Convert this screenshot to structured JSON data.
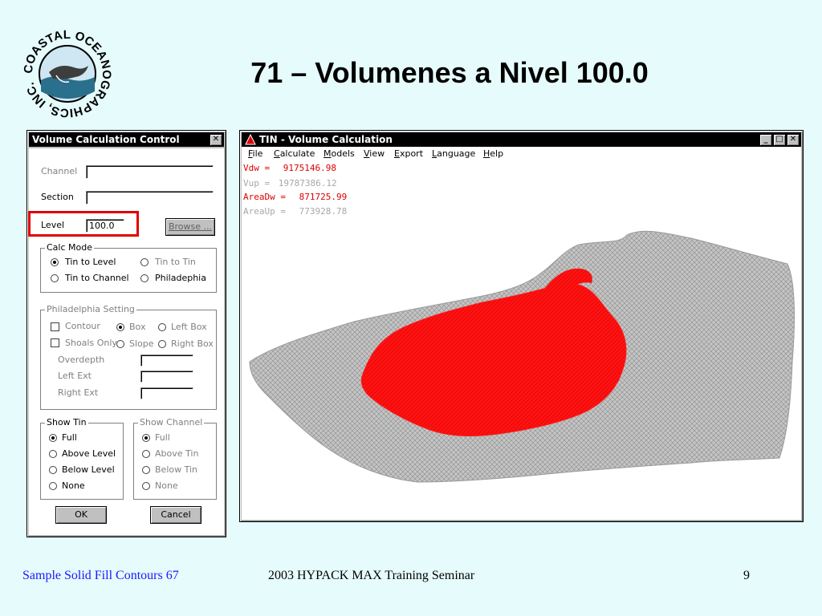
{
  "slide": {
    "title": "71 – Volumenes a Nivel 100.0",
    "logo_text": "COASTAL OCEANOGRAPHICS, INC.",
    "footer_left": "Sample Solid Fill Contours 67",
    "footer_center": "2003 HYPACK MAX Training Seminar",
    "page_number": "9",
    "colors": {
      "background": "#e6fbfb",
      "footer_left": "#1a1aff",
      "highlight_box": "#e00000"
    }
  },
  "dialog": {
    "title": "Volume Calculation Control",
    "close_icon": "close-icon",
    "channel_label": "Channel",
    "channel_value": "",
    "section_label": "Section",
    "section_value": "",
    "level_label": "Level",
    "level_value": "100.0",
    "browse_label": "Browse ...",
    "calc_mode": {
      "label": "Calc Mode",
      "options": [
        "Tin to Level",
        "Tin to Tin",
        "Tin to Channel",
        "Philadephia"
      ],
      "selected": "Tin to Level"
    },
    "philadelphia": {
      "label": "Philadelphia Setting",
      "contour": "Contour",
      "box": "Box",
      "left_box": "Left Box",
      "shoals_only": "Shoals Only",
      "slope": "Slope",
      "right_box": "Right Box",
      "overdepth": "Overdepth",
      "left_ext": "Left Ext",
      "right_ext": "Right Ext"
    },
    "show_tin": {
      "label": "Show Tin",
      "options": [
        "Full",
        "Above Level",
        "Below Level",
        "None"
      ],
      "selected": "Full"
    },
    "show_channel": {
      "label": "Show Channel",
      "options": [
        "Full",
        "Above Tin",
        "Below Tin",
        "None"
      ],
      "selected": "Full"
    },
    "ok_label": "OK",
    "cancel_label": "Cancel"
  },
  "tin_window": {
    "title": "TIN - Volume Calculation",
    "window_icon": "tin-app-icon",
    "menu": [
      "File",
      "Calculate",
      "Models",
      "View",
      "Export",
      "Language",
      "Help"
    ],
    "stats": [
      {
        "label": "Vdw =",
        "value": "9175146.98",
        "color": "red"
      },
      {
        "label": "Vup =",
        "value": "19787386.12",
        "color": "grey"
      },
      {
        "label": "AreaDw =",
        "value": "871725.99",
        "color": "red"
      },
      {
        "label": "AreaUp =",
        "value": "773928.78",
        "color": "grey"
      }
    ],
    "surface_colors": {
      "below_level": "#ff1a1a",
      "terrain": "#b8b8b8"
    }
  }
}
